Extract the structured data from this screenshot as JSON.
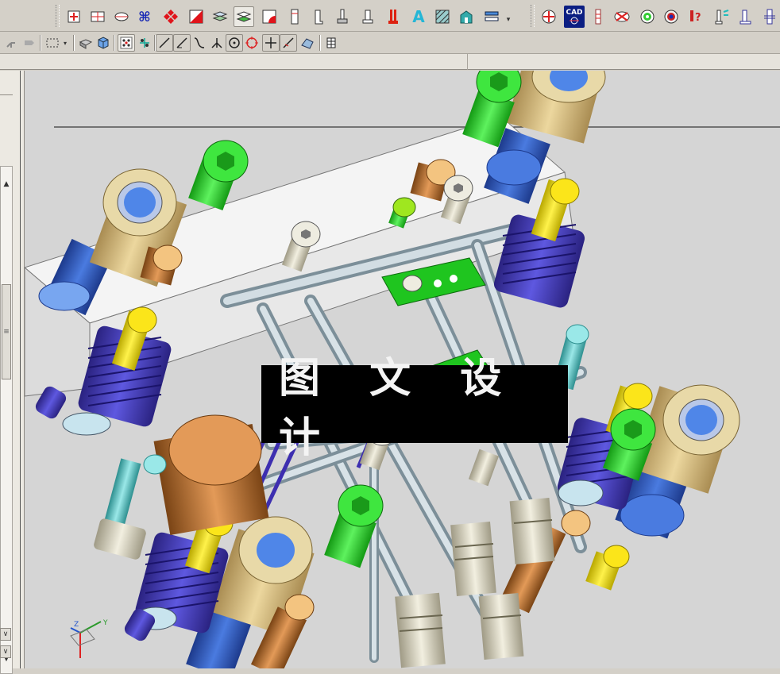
{
  "app": {
    "watermark_text": "图 文 设 计"
  },
  "toolbar_top": {
    "cad_label": "CAD",
    "text_tool_label": "A",
    "query_label": "?",
    "icons": [
      "add-point-icon",
      "rectangle-icon",
      "ellipse-icon",
      "command-key-icon",
      "diamond-pattern-icon",
      "square-diagonal-icon",
      "layers-icon",
      "layer-select-icon",
      "corner-square-icon",
      "tall-rect-icon",
      "bracket-icon",
      "pin-icon",
      "cylinder-icon",
      "red-post-icon",
      "text-tool-icon",
      "hatch-icon",
      "house-icon",
      "list-icon",
      "overflow-chevron-icon",
      "target-red-icon",
      "cad-label-icon",
      "insert-pin-icon",
      "bowtie-icon",
      "green-target-icon",
      "eye-icon",
      "red-query-icon",
      "teal-pin-icon",
      "blue-post-icon",
      "ejector-icon"
    ]
  },
  "toolbar_second": {
    "icons": [
      "transform-icon",
      "move-icon",
      "select-box-icon",
      "dropdown-arrow-icon",
      "solid-icon",
      "cube-icon",
      "point-grid-icon",
      "snap-icon",
      "line-icon",
      "line-angle-icon",
      "curve-icon",
      "fork-icon",
      "circle-center-icon",
      "circle-red-icon",
      "cross-icon",
      "slash-icon",
      "shape-icon",
      "grid-icon"
    ]
  },
  "scene": {
    "axis_labels": {
      "x": "X",
      "y": "Y",
      "z": "Z"
    }
  },
  "colors": {
    "viewport_bg": "#d5d5d5",
    "plate": "#ececec",
    "green": "#2ed12e",
    "blue": "#3f6fd8",
    "purple": "#4b3fbf",
    "tan": "#d9c08a",
    "yellow": "#f2e21a",
    "copper": "#c87a3a",
    "steel": "#aabbc4",
    "teal": "#6ccfcf"
  }
}
